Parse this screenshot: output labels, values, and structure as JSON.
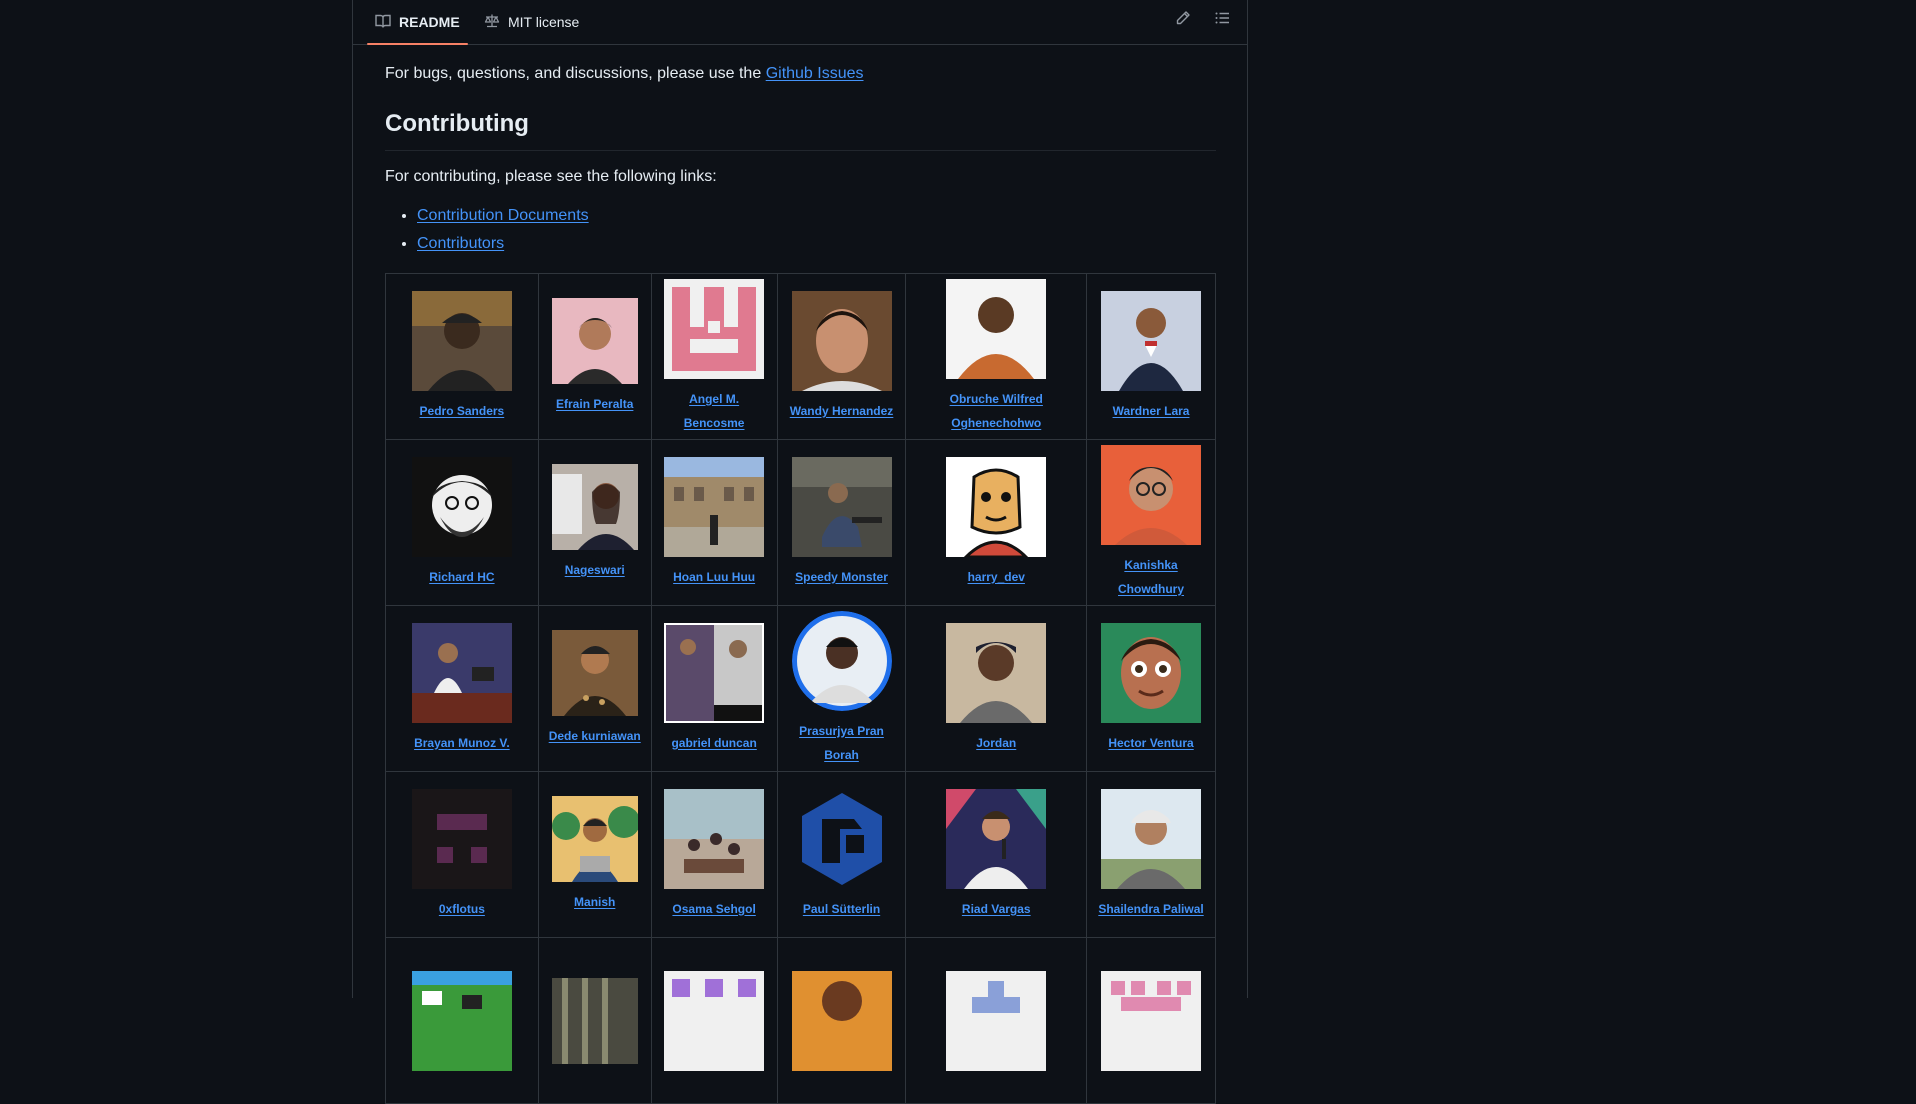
{
  "tabs": {
    "readme": "README",
    "license": "MIT license"
  },
  "intro": {
    "text": "For bugs, questions, and discussions, please use the",
    "link": "Github Issues"
  },
  "contributing": {
    "heading": "Contributing",
    "text": "For contributing, please see the following links:",
    "links": [
      "Contribution Documents",
      "Contributors"
    ]
  },
  "contributors": [
    [
      "Pedro Sanders",
      "Efrain Peralta",
      "Angel M. Bencosme",
      "Wandy Hernandez",
      "Obruche Wilfred Oghenechohwo",
      "Wardner Lara"
    ],
    [
      "Richard HC",
      "Nageswari",
      "Hoan Luu Huu",
      "Speedy Monster",
      "harry_dev",
      "Kanishka Chowdhury"
    ],
    [
      "Brayan Munoz V.",
      "Dede kurniawan",
      "gabriel duncan",
      "Prasurjya Pran Borah",
      "Jordan",
      "Hector Ventura"
    ],
    [
      "0xflotus",
      "Manish",
      "Osama Sehgol",
      "Paul Sütterlin",
      "Riad Vargas",
      "Shailendra Paliwal"
    ]
  ],
  "colors": {
    "background": "#0d1117",
    "text": "#e6edf3",
    "link": "#4493f8",
    "border": "#30363d",
    "tab_accent": "#f78166"
  }
}
